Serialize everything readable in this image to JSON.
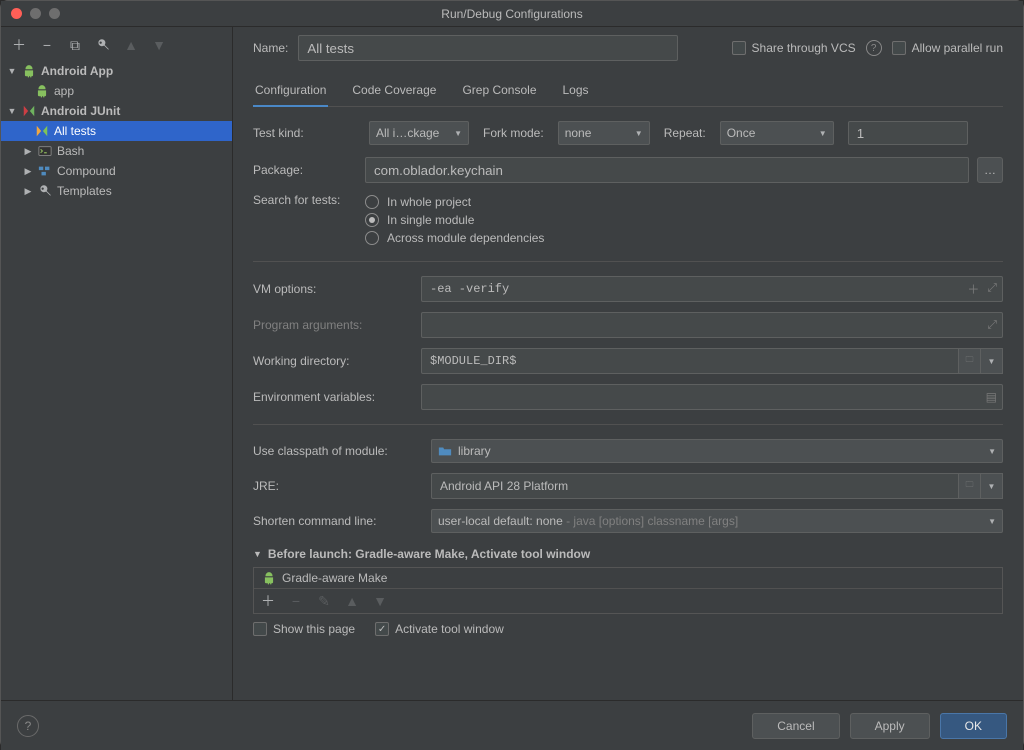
{
  "window": {
    "title": "Run/Debug Configurations"
  },
  "name_label": "Name:",
  "name_value": "All tests",
  "share_vcs": "Share through VCS",
  "allow_parallel": "Allow parallel run",
  "tree": {
    "android_app": "Android App",
    "app": "app",
    "android_junit": "Android JUnit",
    "all_tests": "All tests",
    "bash": "Bash",
    "compound": "Compound",
    "templates": "Templates"
  },
  "tabs": {
    "configuration": "Configuration",
    "code_coverage": "Code Coverage",
    "grep_console": "Grep Console",
    "logs": "Logs"
  },
  "form": {
    "test_kind_label": "Test kind:",
    "test_kind_value": "All i…ckage",
    "fork_mode_label": "Fork mode:",
    "fork_mode_value": "none",
    "repeat_label": "Repeat:",
    "repeat_value": "Once",
    "repeat_count": "1",
    "package_label": "Package:",
    "package_value": "com.oblador.keychain",
    "search_label": "Search for tests:",
    "search_options": {
      "whole": "In whole project",
      "single": "In single module",
      "across": "Across module dependencies"
    },
    "vm_label": "VM options:",
    "vm_value": "-ea -verify",
    "prog_args_label": "Program arguments:",
    "workdir_label": "Working directory:",
    "workdir_value": "$MODULE_DIR$",
    "env_label": "Environment variables:",
    "classpath_label": "Use classpath of module:",
    "classpath_value": "library",
    "jre_label": "JRE:",
    "jre_value": "Android API 28 Platform",
    "shorten_label": "Shorten command line:",
    "shorten_value": "user-local default: none",
    "shorten_hint": " - java [options] classname [args]"
  },
  "before_launch": {
    "header": "Before launch: Gradle-aware Make, Activate tool window",
    "item": "Gradle-aware Make",
    "show_page": "Show this page",
    "activate_tw": "Activate tool window"
  },
  "footer": {
    "cancel": "Cancel",
    "apply": "Apply",
    "ok": "OK"
  }
}
